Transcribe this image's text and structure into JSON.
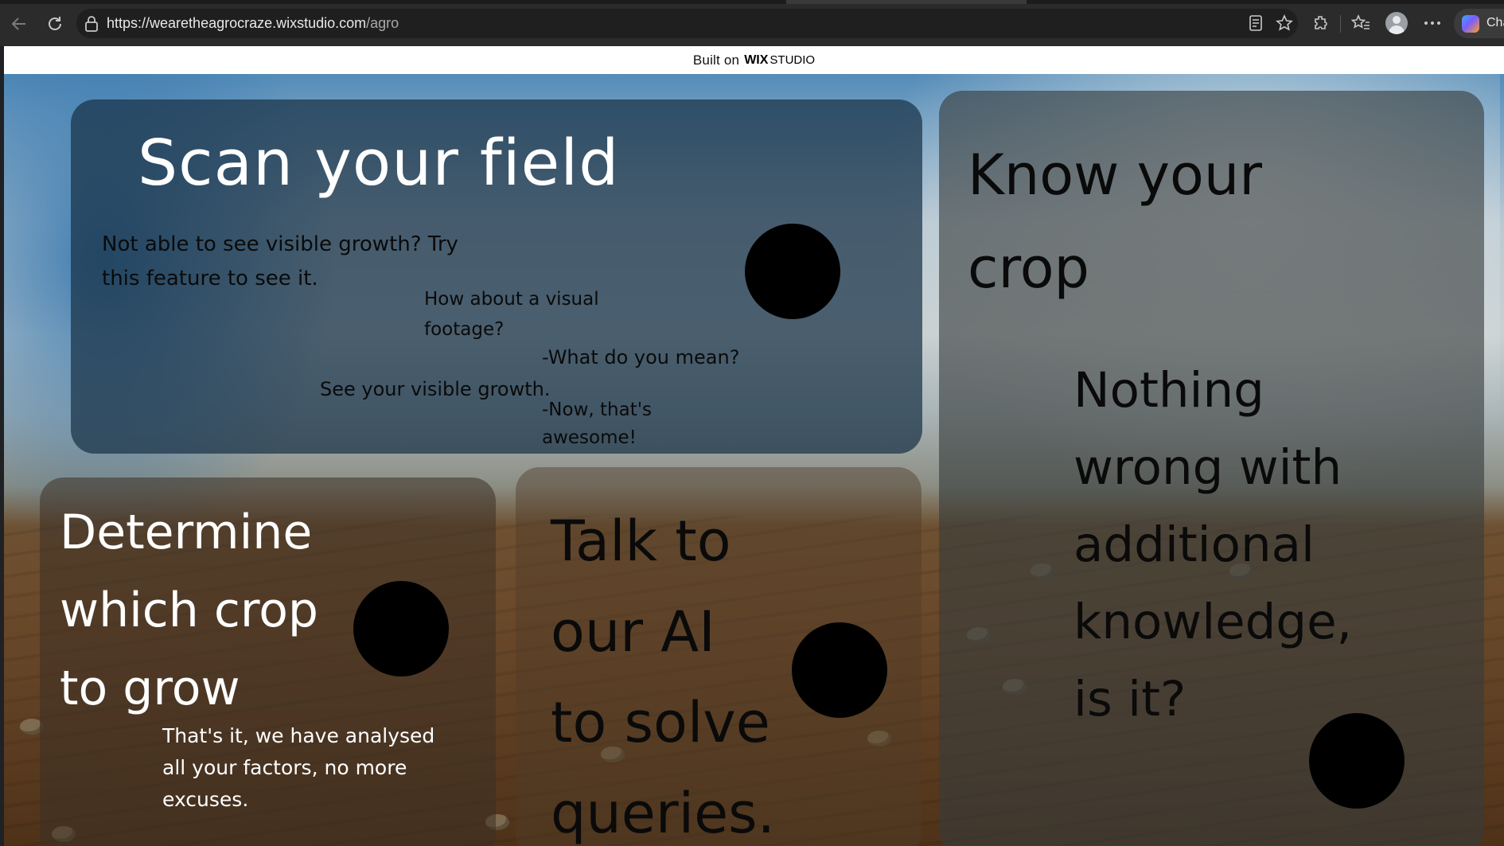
{
  "browser": {
    "url_host": "https://wearetheagrocraze.wixstudio.com",
    "url_path": "/agro",
    "copilot_label": "Cha",
    "icons": [
      "back-icon",
      "reload-icon",
      "lock-icon",
      "reading-view-icon",
      "favorite-star-icon",
      "extensions-icon",
      "favorites-icon",
      "profile-avatar",
      "more-icon",
      "copilot-icon"
    ]
  },
  "banner": {
    "prefix": "Built on",
    "wix": "WIX",
    "studio": "STUDIO"
  },
  "cards": {
    "scan": {
      "title": "Scan your field",
      "subtitle": "Not able to see visible growth? Try\nthis feature to see it.",
      "line_visual": "How about a visual\nfootage?",
      "line_mean": "-What do you mean?",
      "line_growth": "See your visible growth.",
      "line_awesome": "-Now, that's\nawesome!"
    },
    "know": {
      "title": "Know your\ncrop",
      "body": "Nothing\nwrong with\nadditional\nknowledge,\nis it?"
    },
    "determine": {
      "title": "Determine\nwhich crop\nto grow",
      "body": "That's it, we have analysed\nall your factors, no more\nexcuses."
    },
    "talk": {
      "title": "Talk to\nour AI\nto solve\nqueries."
    }
  },
  "colors": {
    "browser_bg": "#2b2b2b",
    "address_bg": "#1f1f1f",
    "white_text": "#ffffff",
    "dark_text": "#0a0a0a"
  }
}
